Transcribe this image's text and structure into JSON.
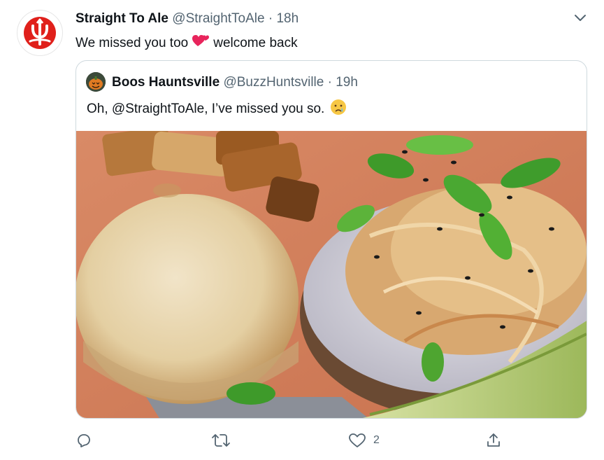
{
  "tweet": {
    "author_name": "Straight To Ale",
    "author_handle": "@StraightToAle",
    "separator": "·",
    "time": "18h",
    "text_before": "We missed you too",
    "emoji": "revolving-hearts",
    "text_after": "welcome back"
  },
  "quoted": {
    "author_name": "Boos Hauntsville",
    "author_handle": "@BuzzHuntsville",
    "separator": "·",
    "time": "19h",
    "text": "Oh, @StraightToAle, I’ve missed you so.",
    "emoji": "crying-face"
  },
  "actions": {
    "reply_icon": "reply-icon",
    "retweet_icon": "retweet-icon",
    "like_icon": "heart-icon",
    "like_count": "2",
    "share_icon": "share-icon"
  },
  "colors": {
    "brand_red": "#e0201b",
    "secondary_text": "#536471",
    "border": "#cfd9de"
  }
}
